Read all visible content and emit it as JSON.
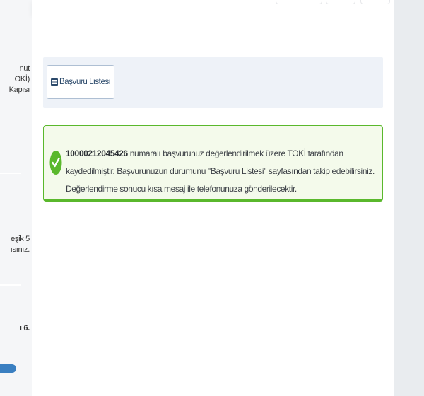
{
  "sidebar": {
    "block1": [
      "nut",
      "OKİ)",
      "Kapısı"
    ],
    "block2": [
      "eşik 5",
      "ısınız."
    ],
    "block3": "ı 6."
  },
  "toolbar": {
    "list_button_label": "Başvuru Listesi",
    "list_button_icon": "list-icon"
  },
  "alert": {
    "type": "success",
    "icon": "check-circle-icon",
    "application_number": "10000212045426",
    "message_part1": " numaralı başvurunuz değerlendirilmek üzere TOKİ tarafından kaydedilmiştir. Başvurunuzun durumunu \"Başvuru Listesi\" sayfasından takip edebilirsiniz. Değerlendirme sonucu kısa mesaj ile telefonunuza gönderilecektir.",
    "accent_color": "#5ab82c",
    "background_color": "#f4faeb"
  }
}
